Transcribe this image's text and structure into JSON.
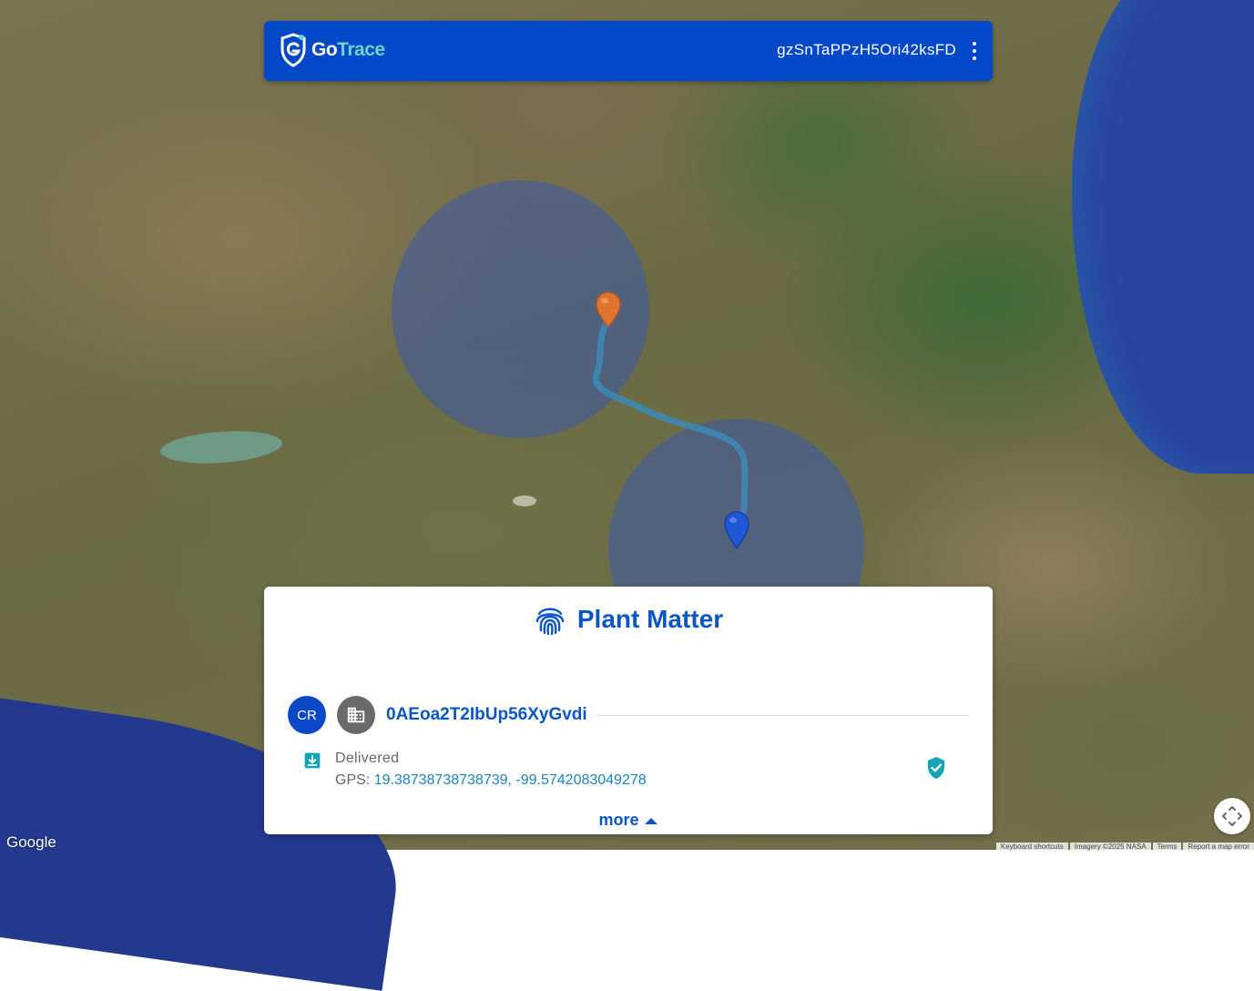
{
  "header": {
    "logo_text_primary": "Go",
    "logo_text_accent": "Trace",
    "tracking_id": "gzSnTaPPzH5Ori42ksFD"
  },
  "panel": {
    "title": "Plant Matter",
    "avatar_initials": "CR",
    "organization_id": "0AEoa2T2IbUp56XyGvdi",
    "event_status": "Delivered",
    "gps_label": "GPS:",
    "gps_value": "19.38738738738739, -99.5742083049278",
    "more_label": "more"
  },
  "map": {
    "provider_logo": "Google",
    "attribution": [
      "Keyboard shortcuts",
      "Imagery ©2025 NASA",
      "Terms",
      "Report a map error"
    ]
  },
  "icons": {
    "logo": "gotrace-shield-icon",
    "menu": "kebab-menu-icon",
    "title": "fingerprint-icon",
    "organization": "building-icon",
    "event": "download-box-icon",
    "verified": "verified-shield-icon",
    "more": "caret-up-icon",
    "origin_marker": "orange-map-pin-icon",
    "destination_marker": "blue-map-pin-icon",
    "map_control": "move-arrows-icon"
  },
  "colors": {
    "brand_blue": "#0348c9",
    "title_blue": "#0a55c8",
    "accent_teal": "#6fd3c6",
    "link_blue": "#1b83c6",
    "verified_teal": "#12a5b5",
    "origin_marker": "#e0742e",
    "destination_marker": "#1f57d6"
  }
}
